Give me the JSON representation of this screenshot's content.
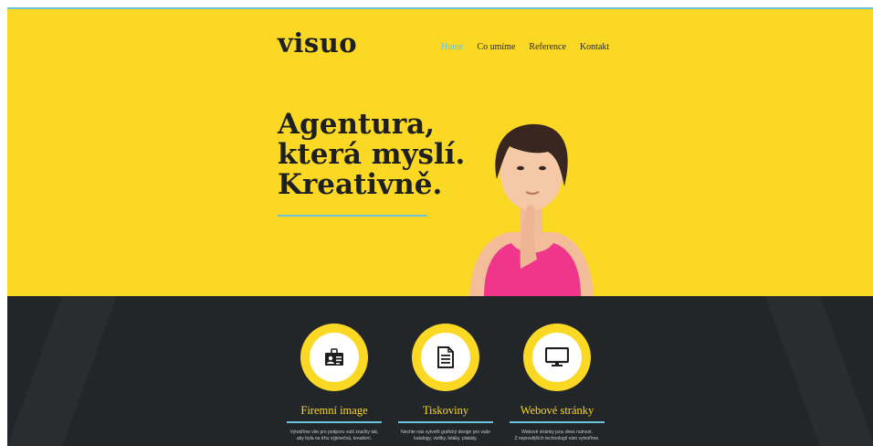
{
  "brand": {
    "logo": "visuo"
  },
  "nav": {
    "items": [
      {
        "label": "Home",
        "active": true
      },
      {
        "label": "Co umíme",
        "active": false
      },
      {
        "label": "Reference",
        "active": false
      },
      {
        "label": "Kontakt",
        "active": false
      }
    ]
  },
  "hero": {
    "headline": [
      "Agentura,",
      "která myslí.",
      "Kreativně."
    ]
  },
  "services": [
    {
      "title": "Firemní image",
      "icon": "id-card-icon",
      "description": "Vytváříme vše pro podporu vaší značky tak,\naby byla na trhu výjimečná, kreativní."
    },
    {
      "title": "Tiskoviny",
      "icon": "document-icon",
      "description": "Nechte nás vytvořit grafický design pro vaše\nkatalogy, vizitky, letáky, plakáty."
    },
    {
      "title": "Webové stránky",
      "icon": "monitor-icon",
      "description": "Webové stránky jsou dnes nutnost.\nZ nejnovějších technologií vám vytvoříme."
    }
  ],
  "colors": {
    "accent_yellow": "#fbd824",
    "accent_blue": "#6cc4dc",
    "dark": "#232629"
  }
}
